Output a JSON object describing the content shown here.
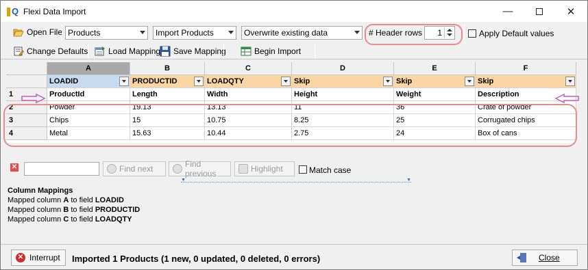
{
  "window": {
    "title": "Flexi Data Import",
    "min_glyph": "—",
    "close_glyph": "✕"
  },
  "toolbar": {
    "open_file": "Open File",
    "entity_combo": "Products",
    "action_combo": "Import Products",
    "mode_combo": "Overwrite existing data",
    "header_rows_label": "# Header rows",
    "header_rows_value": "1",
    "apply_defaults_label": "Apply Default values",
    "change_defaults": "Change Defaults",
    "load_mapping": "Load Mapping",
    "save_mapping": "Save Mapping",
    "begin_import": "Begin Import"
  },
  "grid": {
    "columns": [
      "A",
      "B",
      "C",
      "D",
      "E",
      "F"
    ],
    "field_mappings": [
      "LOADID",
      "PRODUCTID",
      "LOADQTY",
      "Skip",
      "Skip",
      "Skip"
    ],
    "row_numbers": [
      "1",
      "2",
      "3",
      "4"
    ],
    "rows": [
      [
        "ProductId",
        "Length",
        "Width",
        "Height",
        "Weight",
        "Description"
      ],
      [
        "Powder",
        "19.13",
        "13.13",
        "11",
        "36",
        "Crate of powder"
      ],
      [
        "Chips",
        "15",
        "10.75",
        "8.25",
        "25",
        "Corrugated chips"
      ],
      [
        "Metal",
        "15.63",
        "10.44",
        "2.75",
        "24",
        "Box of cans"
      ]
    ]
  },
  "findbar": {
    "find_next": "Find next",
    "find_previous": "Find previous",
    "highlight": "Highlight",
    "match_case": "Match case"
  },
  "mappings": {
    "title": "Column Mappings",
    "items": [
      {
        "prefix": "Mapped column ",
        "column": "A",
        "mid": " to field ",
        "field": "LOADID"
      },
      {
        "prefix": "Mapped column ",
        "column": "B",
        "mid": " to field ",
        "field": "PRODUCTID"
      },
      {
        "prefix": "Mapped column ",
        "column": "C",
        "mid": " to field ",
        "field": "LOADQTY"
      }
    ]
  },
  "status": {
    "interrupt": "Interrupt",
    "message": "Imported 1 Products (1 new, 0 updated, 0 deleted, 0 errors)",
    "close": "Close"
  },
  "colors": {
    "field_row": "#fbd5a3",
    "field_row_selected": "#c6dbef",
    "annotation": "#e58b8b",
    "arrow": "#c45cc4"
  }
}
